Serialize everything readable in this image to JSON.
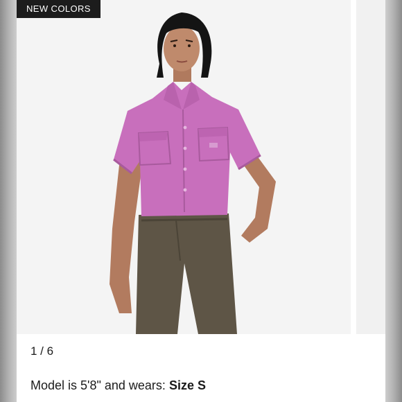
{
  "gallery": {
    "badge": "NEW COLORS",
    "counter": "1 / 6",
    "caption_prefix": "Model is 5'8\" and wears: ",
    "caption_size": "Size S"
  },
  "colors": {
    "shirt": "#c86fbc",
    "pants": "#5e5546",
    "badge_bg": "#1c1c1c",
    "photo_bg": "#f4f4f4"
  }
}
